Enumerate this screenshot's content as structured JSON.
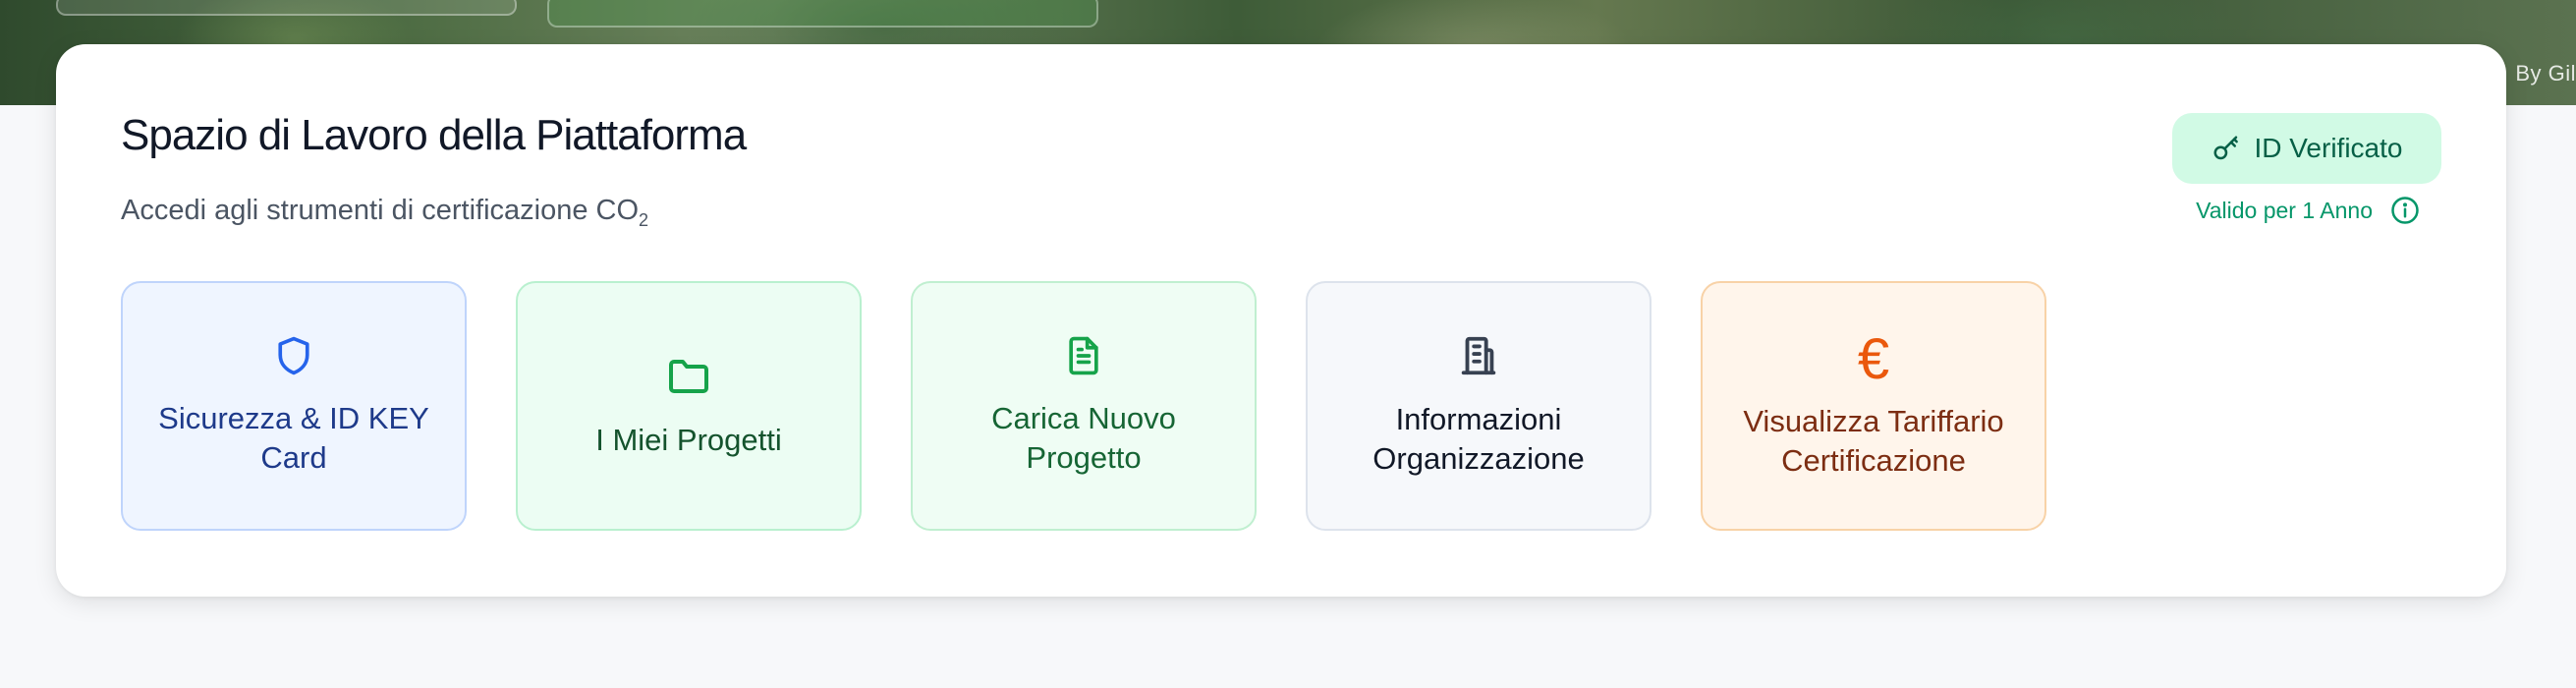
{
  "hero": {
    "credit": "By Gil"
  },
  "workspace": {
    "title": "Spazio di Lavoro della Piattaforma",
    "subtitle": "Accedi agli strumenti di certificazione CO",
    "subtitle_subscript": "2",
    "badge": {
      "label": "ID Verificato",
      "icon": "key-icon"
    },
    "validity": {
      "label": "Valido per 1 Anno",
      "icon": "info-icon"
    }
  },
  "tiles": [
    {
      "label": "Sicurezza & ID KEY Card",
      "icon": "shield-icon",
      "accent": "#2563eb"
    },
    {
      "label": "I Miei Progetti",
      "icon": "folder-icon",
      "accent": "#16a34a"
    },
    {
      "label": "Carica Nuovo Progetto",
      "icon": "document-icon",
      "accent": "#16a34a"
    },
    {
      "label": "Informazioni Organizzazione",
      "icon": "building-icon",
      "accent": "#374151"
    },
    {
      "label": "Visualizza Tariffario Certificazione",
      "icon": "euro-icon",
      "glyph": "€",
      "accent": "#ea580c"
    }
  ]
}
